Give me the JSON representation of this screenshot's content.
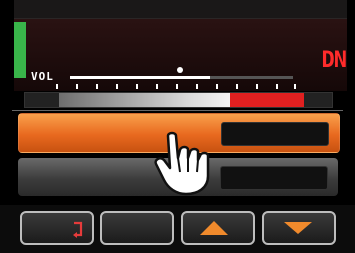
{
  "status": {
    "volume_label": "VOL",
    "indicator": "DN",
    "signal_level": 1
  },
  "buttons": {
    "top_field_value": "",
    "bottom_field_value": ""
  },
  "softkeys": [
    {
      "name": "back",
      "icon": "back-arrow-icon"
    },
    {
      "name": "blank",
      "icon": ""
    },
    {
      "name": "up",
      "icon": "up-arrow-icon"
    },
    {
      "name": "down",
      "icon": "down-arrow-icon"
    }
  ],
  "colors": {
    "accent": "#e8691f",
    "indicator": "#ff2b2b",
    "signal": "#39b54a"
  }
}
